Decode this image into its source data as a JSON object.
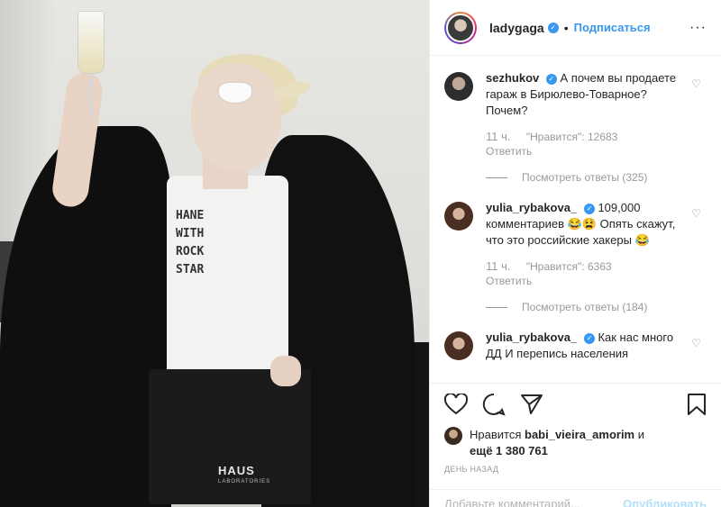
{
  "post": {
    "username": "ladygaga",
    "verified": true,
    "follow_label": "Подписаться",
    "separator": "•",
    "more_label": "···"
  },
  "photo": {
    "shirt_lines": [
      "HANE",
      "WITH",
      "ROCK",
      "STAR"
    ],
    "brand": "HAUS",
    "brand_sub": "LABORATORIES"
  },
  "comments": [
    {
      "user": "sezhukov",
      "verified": true,
      "text": "А почем вы продаете гараж в Бирюлево-Товарное? Почем?",
      "time": "11 ч.",
      "likes": "\"Нравится\": 12683",
      "reply_label": "Ответить",
      "view_replies": "Посмотреть ответы (325)"
    },
    {
      "user": "yulia_rybakova_",
      "verified": true,
      "text": "109,000 комментариев 😂😫 Опять скажут, что это российские хакеры 😂",
      "time": "11 ч.",
      "likes": "\"Нравится\": 6363",
      "reply_label": "Ответить",
      "view_replies": "Посмотреть ответы (184)"
    },
    {
      "user": "yulia_rybakova_",
      "verified": true,
      "text": "Как нас много ДД И перепись населения",
      "time": "",
      "likes": "",
      "reply_label": "",
      "view_replies": ""
    }
  ],
  "likes": {
    "prefix": "Нравится",
    "user": "babi_vieira_amorim",
    "suffix": "и",
    "more": "ещё 1 380 761"
  },
  "date": "день назад",
  "add_comment": {
    "placeholder": "Добавьте комментарий...",
    "publish": "Опубликовать"
  },
  "icons": {
    "like": "heart-icon",
    "comment": "comment-icon",
    "share": "share-icon",
    "save": "bookmark-icon",
    "verified": "verified-badge-icon",
    "more": "more-options-icon"
  },
  "colors": {
    "accent": "#3897f0",
    "muted": "#999999",
    "text": "#262626"
  }
}
